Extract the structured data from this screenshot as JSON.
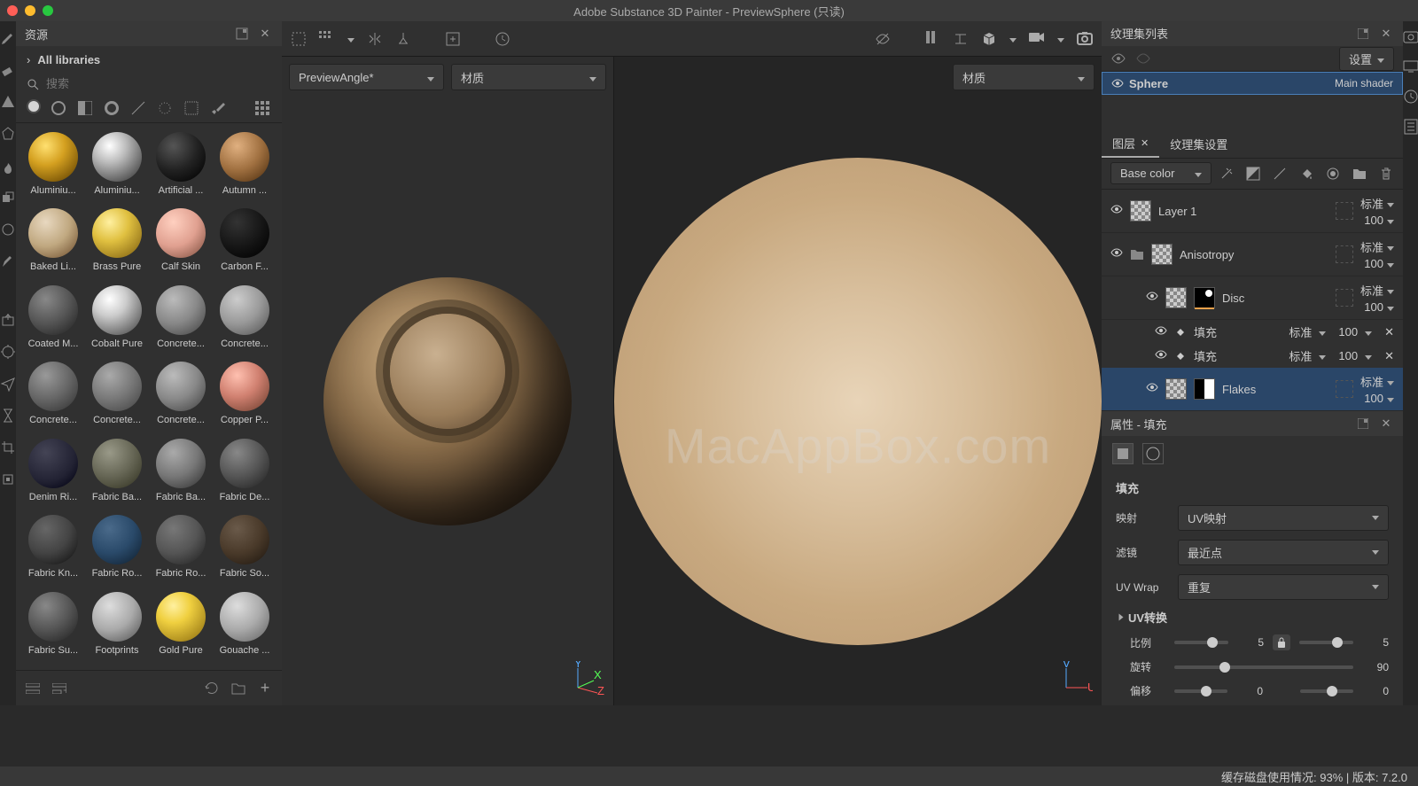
{
  "title": "Adobe Substance 3D Painter - PreviewSphere (只读)",
  "assets": {
    "panel_title": "资源",
    "libraries": "All libraries",
    "search_placeholder": "搜索",
    "items": [
      {
        "label": "Aluminiu..."
      },
      {
        "label": "Aluminiu..."
      },
      {
        "label": "Artificial ..."
      },
      {
        "label": "Autumn ..."
      },
      {
        "label": "Baked Li..."
      },
      {
        "label": "Brass Pure"
      },
      {
        "label": "Calf Skin"
      },
      {
        "label": "Carbon F..."
      },
      {
        "label": "Coated M..."
      },
      {
        "label": "Cobalt Pure"
      },
      {
        "label": "Concrete..."
      },
      {
        "label": "Concrete..."
      },
      {
        "label": "Concrete..."
      },
      {
        "label": "Concrete..."
      },
      {
        "label": "Concrete..."
      },
      {
        "label": "Copper P..."
      },
      {
        "label": "Denim Ri..."
      },
      {
        "label": "Fabric Ba..."
      },
      {
        "label": "Fabric Ba..."
      },
      {
        "label": "Fabric De..."
      },
      {
        "label": "Fabric Kn..."
      },
      {
        "label": "Fabric Ro..."
      },
      {
        "label": "Fabric Ro..."
      },
      {
        "label": "Fabric So..."
      },
      {
        "label": "Fabric Su..."
      },
      {
        "label": "Footprints"
      },
      {
        "label": "Gold Pure"
      },
      {
        "label": "Gouache ..."
      }
    ]
  },
  "viewport": {
    "dropdown1": "PreviewAngle*",
    "dropdown2": "材质",
    "dropdown3": "材质"
  },
  "watermark": "MacAppBox.com",
  "texSets": {
    "title": "纹理集列表",
    "settings": "设置",
    "sphere": "Sphere",
    "shader": "Main shader"
  },
  "layers": {
    "tab_layers": "图层",
    "tab_texset": "纹理集设置",
    "channel": "Base color",
    "items": {
      "layer1": "Layer 1",
      "aniso": "Anisotropy",
      "disc": "Disc",
      "fill": "填充",
      "flakes": "Flakes"
    },
    "blend": "标准",
    "opacity": "100",
    "fill_blend": "标准",
    "fill_opacity": "100"
  },
  "props": {
    "title": "属性 - 填充",
    "section": "填充",
    "mapping_label": "映射",
    "mapping": "UV映射",
    "filter_label": "滤镜",
    "filter": "最近点",
    "wrap_label": "UV Wrap",
    "wrap": "重复",
    "uv_trans": "UV转换",
    "scale_label": "比例",
    "scale_x": "5",
    "scale_y": "5",
    "rot_label": "旋转",
    "rot": "90",
    "offset_label": "偏移",
    "offset_x": "0",
    "offset_y": "0"
  },
  "status": "缓存磁盘使用情况:  93% | 版本:  7.2.0"
}
